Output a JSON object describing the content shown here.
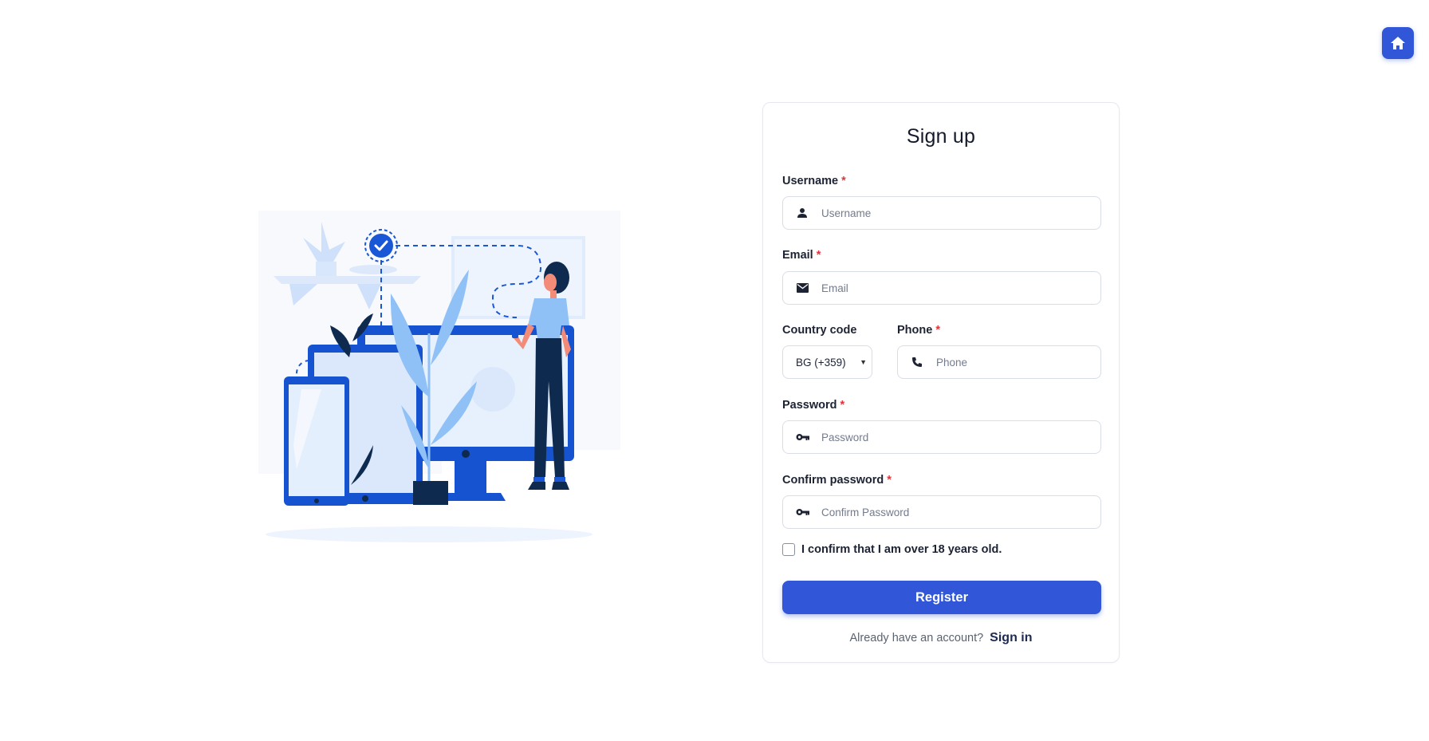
{
  "home": {
    "icon": "home-icon"
  },
  "form": {
    "title": "Sign up",
    "username": {
      "label": "Username",
      "required": "*",
      "placeholder": "Username",
      "icon": "person-icon"
    },
    "email": {
      "label": "Email",
      "required": "*",
      "placeholder": "Email",
      "icon": "mail-icon"
    },
    "country_code": {
      "label": "Country code",
      "value": "BG (+359)"
    },
    "phone": {
      "label": "Phone",
      "required": "*",
      "placeholder": "Phone",
      "icon": "phone-icon"
    },
    "password": {
      "label": "Password",
      "required": "*",
      "placeholder": "Password",
      "icon": "key-icon"
    },
    "confirm_password": {
      "label": "Confirm password",
      "required": "*",
      "placeholder": "Confirm Password",
      "icon": "key-icon"
    },
    "age_confirm": {
      "label": "I confirm that I am over 18 years old.",
      "checked": false
    },
    "register_label": "Register",
    "signin_prompt": "Already have an account?",
    "signin_link": "Sign in"
  },
  "colors": {
    "accent": "#3157d8",
    "required": "#e0353b",
    "illustration_primary": "#0a4bd1",
    "illustration_light": "#8fc1f7",
    "illustration_pale": "#e4effd",
    "illustration_dark": "#0f2a4f"
  }
}
